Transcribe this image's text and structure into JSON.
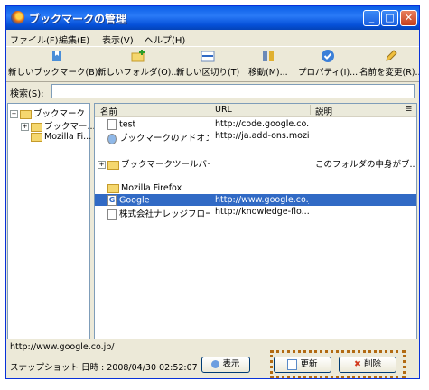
{
  "window": {
    "title": "ブックマークの管理"
  },
  "menu": [
    "ファイル(F)",
    "編集(E)",
    "表示(V)",
    "ヘルプ(H)"
  ],
  "toolbar": [
    "新しいブックマーク(B)...",
    "新しいフォルダ(O)...",
    "新しい区切り(T)",
    "移動(M)...",
    "プロパティ(I)...",
    "名前を変更(R)..."
  ],
  "search": {
    "label": "検索(S):",
    "value": ""
  },
  "tree": [
    "ブックマーク",
    "ブックマー...",
    "Mozilla Fi..."
  ],
  "columns": {
    "name": "名前",
    "url": "URL",
    "desc": "説明"
  },
  "rows": [
    {
      "name": "test",
      "url": "http://code.google.co...",
      "desc": ""
    },
    {
      "name": "ブックマークのアドオンを...",
      "url": "http://ja.add-ons.mozi...",
      "desc": ""
    },
    {
      "name": "ブックマークツールバーフ...",
      "url": "",
      "desc": "このフォルダの中身がブ..."
    },
    {
      "name": "Mozilla Firefox",
      "url": "",
      "desc": ""
    },
    {
      "name": "Google",
      "url": "http://www.google.co.j...",
      "desc": ""
    },
    {
      "name": "株式会社ナレッジフロー",
      "url": "http://knowledge-flo...",
      "desc": ""
    }
  ],
  "status": {
    "url": "http://www.google.co.jp/",
    "snapshot": "スナップショット 日時 : 2008/04/30 02:52:07"
  },
  "buttons": {
    "show": "表示",
    "update": "更新",
    "delete": "削除"
  },
  "colors": {
    "selection": "#316ac5",
    "annotation": "#b26a12"
  }
}
